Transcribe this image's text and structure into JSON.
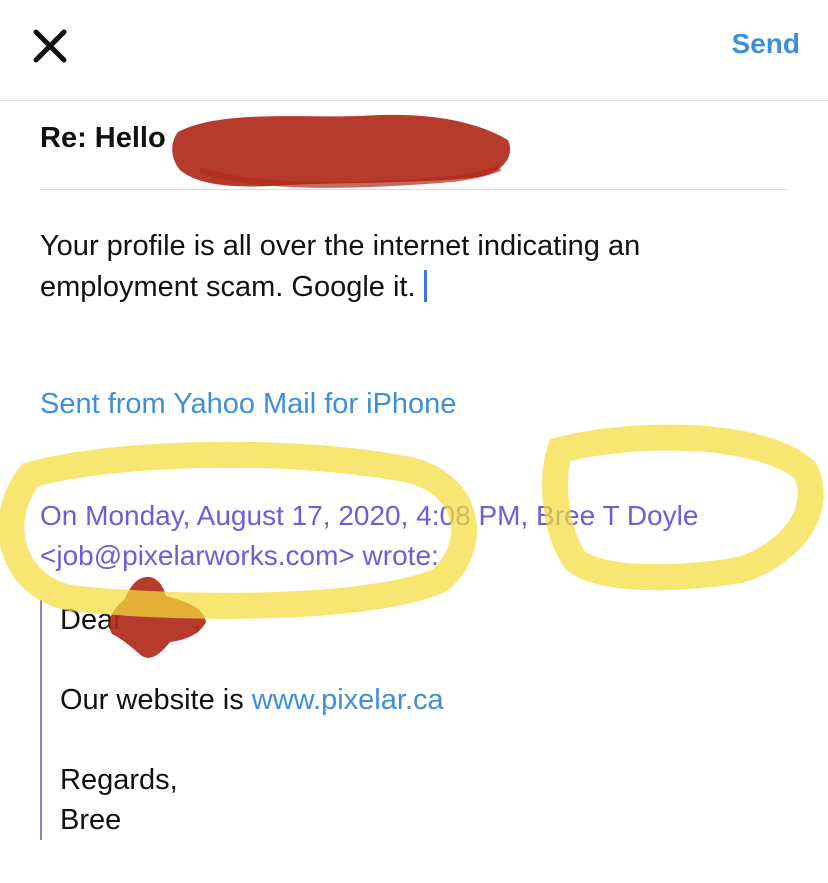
{
  "toolbar": {
    "close_icon": "close-icon",
    "send_label": "Send",
    "accent_color": "#3f8fd8"
  },
  "subject": "Re: Hello",
  "body_lines": [
    "Your profile is all over the internet indicating an",
    "employment scam. Google it."
  ],
  "signature": "Sent from Yahoo Mail for iPhone",
  "quote_header": {
    "line1_date": "On Monday, August 17, 2020, 4:08 PM,",
    "line1_name": "Bree T Doyle",
    "line2": "<job@pixelarworks.com> wrote:"
  },
  "quoted_message": {
    "greeting": "Dear",
    "greeting_suffix": ",",
    "website_prefix": "Our website is",
    "website_link": "www.pixelar.ca",
    "closing": "Regards,",
    "sender": "Bree"
  },
  "annotations": {
    "redaction_color": "#b02a1a",
    "highlight_color": "#f5dc3c"
  }
}
